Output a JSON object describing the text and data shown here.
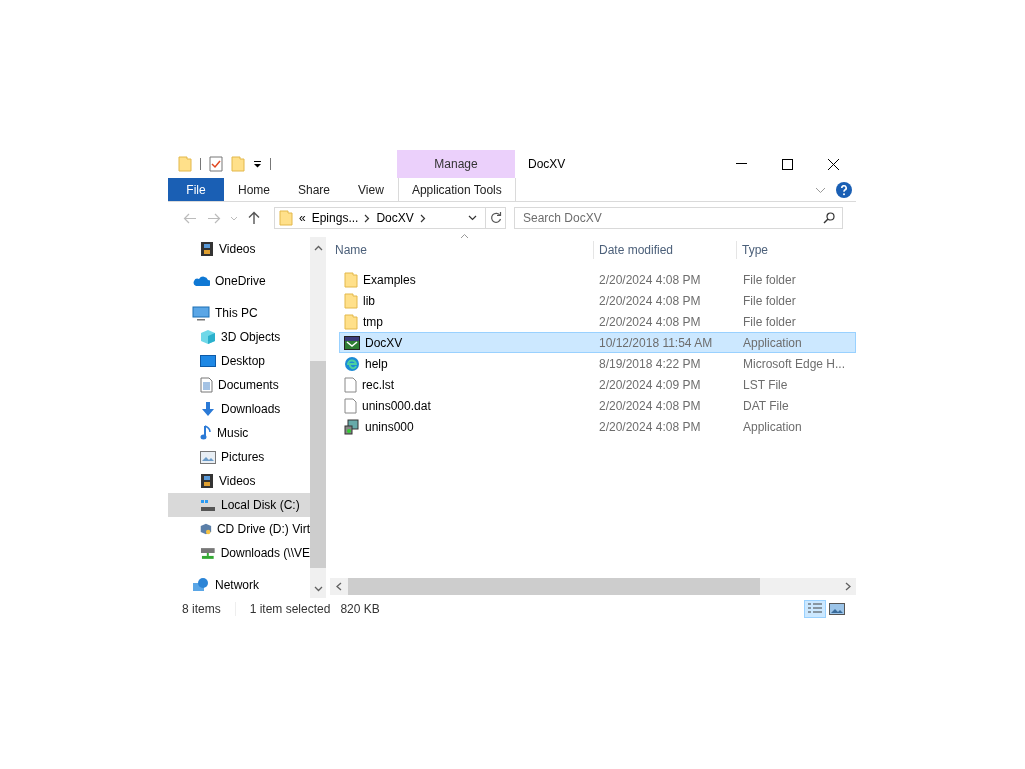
{
  "window": {
    "title": "DocXV",
    "context_tab": "Manage"
  },
  "ribbon_tabs": [
    {
      "label": "File",
      "kind": "file"
    },
    {
      "label": "Home",
      "kind": "tab"
    },
    {
      "label": "Share",
      "kind": "tab"
    },
    {
      "label": "View",
      "kind": "tab"
    },
    {
      "label": "Application Tools",
      "kind": "context"
    }
  ],
  "address": {
    "overflow": "«",
    "path": [
      "Epings...",
      "DocXV"
    ]
  },
  "search": {
    "placeholder": "Search DocXV"
  },
  "sidebar": {
    "items": [
      {
        "children": [
          {
            "label": "Videos",
            "kind": "videos",
            "selected": false
          }
        ]
      },
      {
        "label": "OneDrive",
        "kind": "cloud",
        "selected": false
      },
      {
        "label": "This PC",
        "kind": "pc",
        "selected": false,
        "children": [
          {
            "label": "3D Objects",
            "kind": "objects",
            "selected": false
          },
          {
            "label": "Desktop",
            "kind": "desktop",
            "selected": false
          },
          {
            "label": "Documents",
            "kind": "documents",
            "selected": false
          },
          {
            "label": "Downloads",
            "kind": "downloads",
            "selected": false
          },
          {
            "label": "Music",
            "kind": "music",
            "selected": false
          },
          {
            "label": "Pictures",
            "kind": "pictures",
            "selected": false
          },
          {
            "label": "Videos",
            "kind": "videos",
            "selected": false
          },
          {
            "label": "Local Disk (C:)",
            "kind": "disk",
            "selected": true
          },
          {
            "label": "CD Drive (D:) Virt",
            "kind": "cd",
            "selected": false
          },
          {
            "label": "Downloads (\\\\VE",
            "kind": "netdrive",
            "selected": false
          }
        ]
      },
      {
        "label": "Network",
        "kind": "network",
        "selected": false
      }
    ]
  },
  "table": {
    "columns": [
      "Name",
      "Date modified",
      "Type"
    ],
    "rows": [
      {
        "name": "Examples",
        "date": "2/20/2024 4:08 PM",
        "type": "File folder",
        "kind": "folder",
        "selected": false
      },
      {
        "name": "lib",
        "date": "2/20/2024 4:08 PM",
        "type": "File folder",
        "kind": "folder",
        "selected": false
      },
      {
        "name": "tmp",
        "date": "2/20/2024 4:08 PM",
        "type": "File folder",
        "kind": "folder",
        "selected": false
      },
      {
        "name": "DocXV",
        "date": "10/12/2018 11:54 AM",
        "type": "Application",
        "kind": "app",
        "selected": true
      },
      {
        "name": "help",
        "date": "8/19/2018 4:22 PM",
        "type": "Microsoft Edge H...",
        "kind": "webpage",
        "selected": false
      },
      {
        "name": "rec.lst",
        "date": "2/20/2024 4:09 PM",
        "type": "LST File",
        "kind": "file",
        "selected": false
      },
      {
        "name": "unins000.dat",
        "date": "2/20/2024 4:08 PM",
        "type": "DAT File",
        "kind": "file",
        "selected": false
      },
      {
        "name": "unins000",
        "date": "2/20/2024 4:08 PM",
        "type": "Application",
        "kind": "installer",
        "selected": false
      }
    ]
  },
  "status_bar": {
    "count": "8 items",
    "selection": "1 item selected",
    "size": "820 KB",
    "views": [
      {
        "kind": "details",
        "selected": true
      },
      {
        "kind": "large",
        "selected": false
      }
    ]
  }
}
